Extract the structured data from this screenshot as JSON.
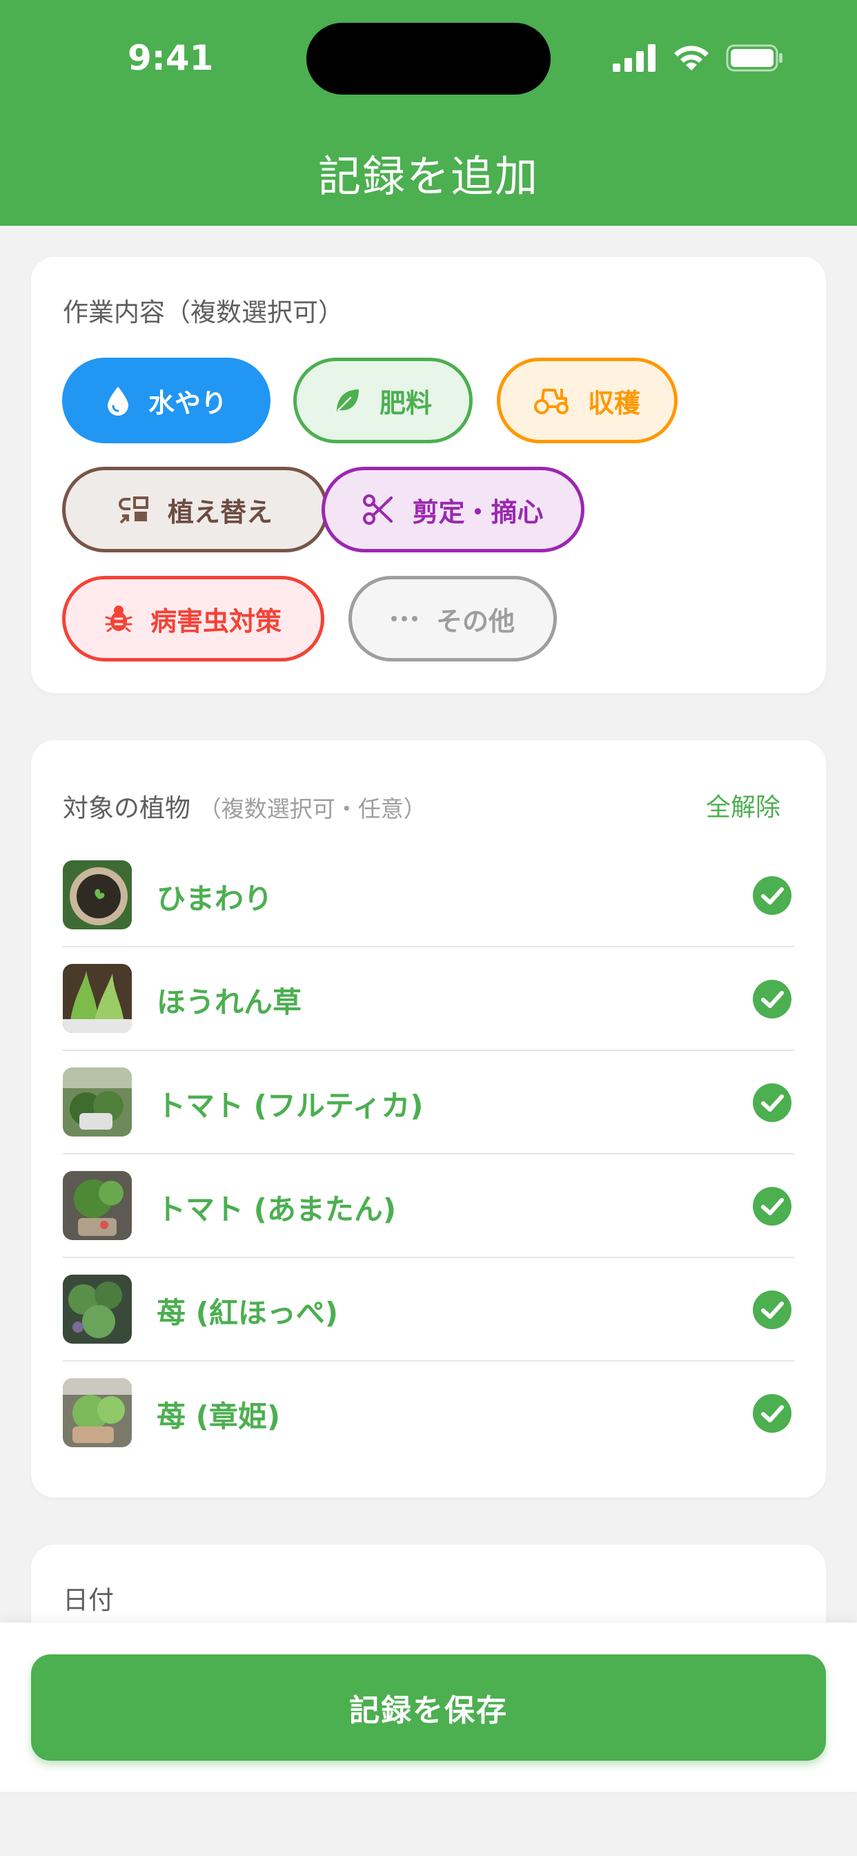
{
  "status_bar": {
    "time": "9:41"
  },
  "header": {
    "title": "記録を追加"
  },
  "task_section": {
    "label": "作業内容（複数選択可）",
    "chips": [
      {
        "label": "水やり",
        "icon": "water-drop-icon",
        "color": "#2196f3",
        "selected": true
      },
      {
        "label": "肥料",
        "icon": "leaf-icon",
        "color": "#4caf50",
        "selected": false
      },
      {
        "label": "収穫",
        "icon": "tractor-icon",
        "color": "#ff9800",
        "selected": false
      },
      {
        "label": "植え替え",
        "icon": "repot-icon",
        "color": "#795548",
        "selected": false
      },
      {
        "label": "剪定・摘心",
        "icon": "scissors-icon",
        "color": "#9c27b0",
        "selected": false
      },
      {
        "label": "病害虫対策",
        "icon": "bug-icon",
        "color": "#f44336",
        "selected": false
      },
      {
        "label": "その他",
        "icon": "more-icon",
        "color": "#9e9e9e",
        "selected": false
      }
    ]
  },
  "plants_section": {
    "label": "対象の植物",
    "hint": "（複数選択可・任意）",
    "clear_all": "全解除",
    "plants": [
      {
        "name": "ひまわり",
        "checked": true
      },
      {
        "name": "ほうれん草",
        "checked": true
      },
      {
        "name": "トマト (フルティカ)",
        "checked": true
      },
      {
        "name": "トマト (あまたん)",
        "checked": true
      },
      {
        "name": "苺 (紅ほっぺ)",
        "checked": true
      },
      {
        "name": "苺 (章姫)",
        "checked": true
      }
    ]
  },
  "date_section": {
    "label": "日付"
  },
  "footer": {
    "save_label": "記録を保存"
  },
  "colors": {
    "primary": "#4caf50",
    "background": "#f2f2f2"
  }
}
